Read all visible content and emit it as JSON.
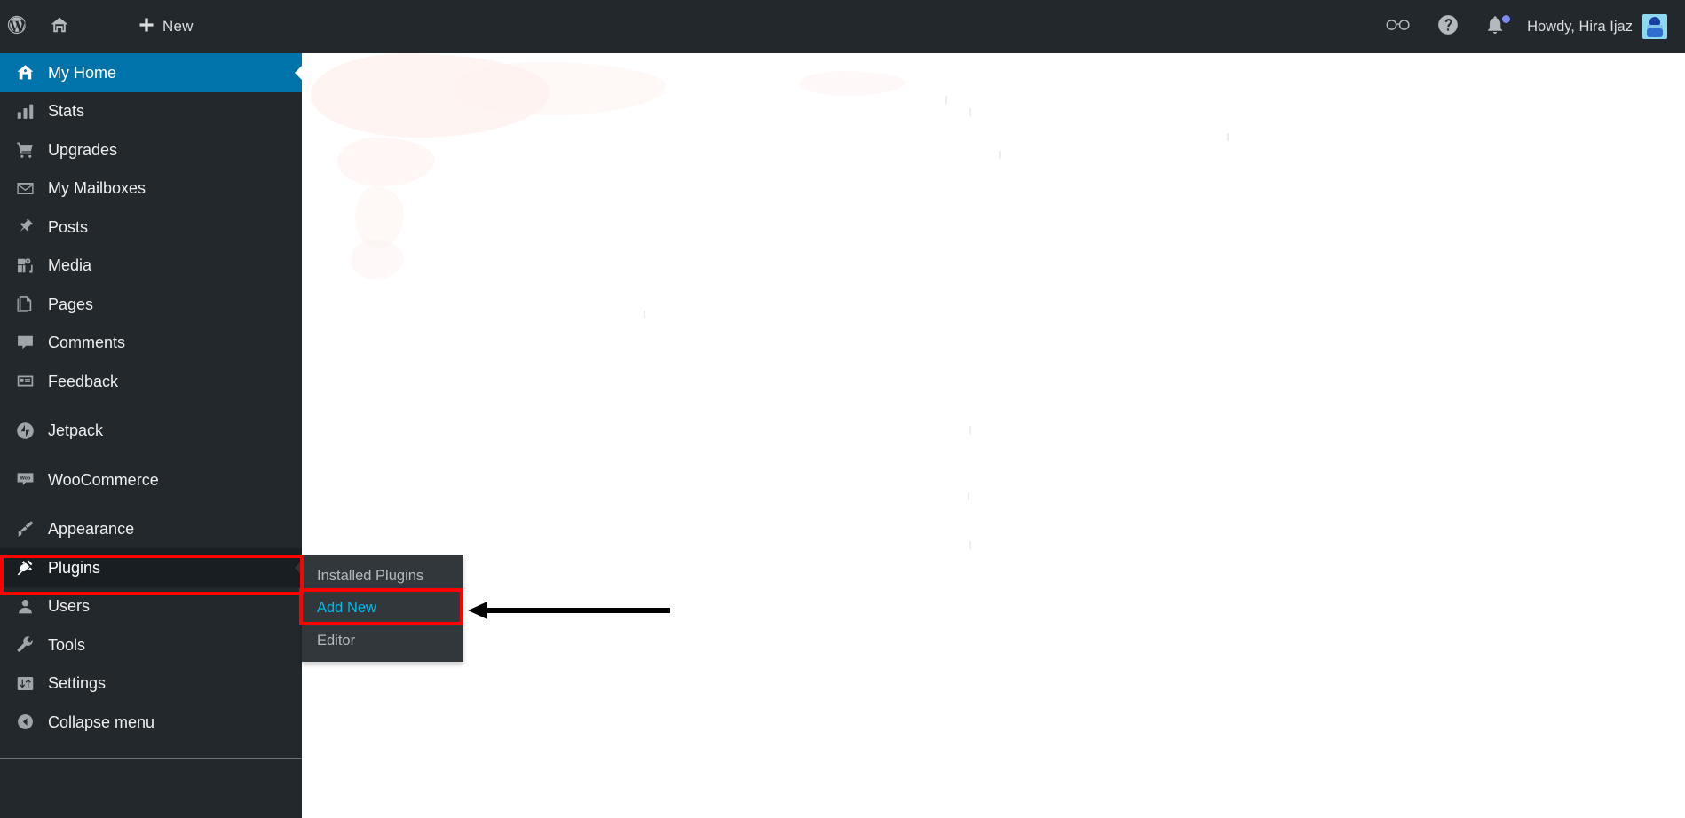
{
  "adminbar": {
    "wp_logo_label": "WordPress",
    "home_label": "Home",
    "new_label": "New",
    "glasses_label": "",
    "help_label": "",
    "notifications_label": "",
    "greeting": "Howdy, Hira Ijaz"
  },
  "sidebar": {
    "items": [
      {
        "label": "My Home",
        "icon": "home-icon",
        "state": "current"
      },
      {
        "label": "Stats",
        "icon": "chart-bar-icon",
        "state": ""
      },
      {
        "label": "Upgrades",
        "icon": "cart-icon",
        "state": ""
      },
      {
        "label": "My Mailboxes",
        "icon": "envelope-icon",
        "state": ""
      },
      {
        "label": "Posts",
        "icon": "pushpin-icon",
        "state": ""
      },
      {
        "label": "Media",
        "icon": "media-icon",
        "state": ""
      },
      {
        "label": "Pages",
        "icon": "pages-icon",
        "state": ""
      },
      {
        "label": "Comments",
        "icon": "comment-icon",
        "state": ""
      },
      {
        "label": "Feedback",
        "icon": "feedback-icon",
        "state": ""
      },
      {
        "label": "Jetpack",
        "icon": "jetpack-icon",
        "state": ""
      },
      {
        "label": "WooCommerce",
        "icon": "woocommerce-icon",
        "state": ""
      },
      {
        "label": "Appearance",
        "icon": "paintbrush-icon",
        "state": ""
      },
      {
        "label": "Plugins",
        "icon": "plug-icon",
        "state": "open"
      },
      {
        "label": "Users",
        "icon": "user-icon",
        "state": ""
      },
      {
        "label": "Tools",
        "icon": "wrench-icon",
        "state": ""
      },
      {
        "label": "Settings",
        "icon": "sliders-icon",
        "state": ""
      },
      {
        "label": "Collapse menu",
        "icon": "collapse-icon",
        "state": ""
      }
    ]
  },
  "submenu": {
    "title": "Plugins",
    "items": [
      {
        "label": "Installed Plugins",
        "active": false
      },
      {
        "label": "Add New",
        "active": true
      },
      {
        "label": "Editor",
        "active": false
      }
    ]
  },
  "annotations": {
    "plugins_box_color": "#fe0000",
    "addnew_box_color": "#fe0000",
    "arrow_color": "#000000",
    "arrow_direction": "left",
    "arrow_target": "Add New"
  },
  "colors": {
    "adminbar_bg": "#23282d",
    "sidebar_bg": "#23282d",
    "submenu_bg": "#32373c",
    "active_blue": "#0073aa",
    "link_blue": "#00b9eb",
    "hover_bg": "#191e23",
    "text_muted": "#b4b9be",
    "content_bg": "#ffffff"
  }
}
